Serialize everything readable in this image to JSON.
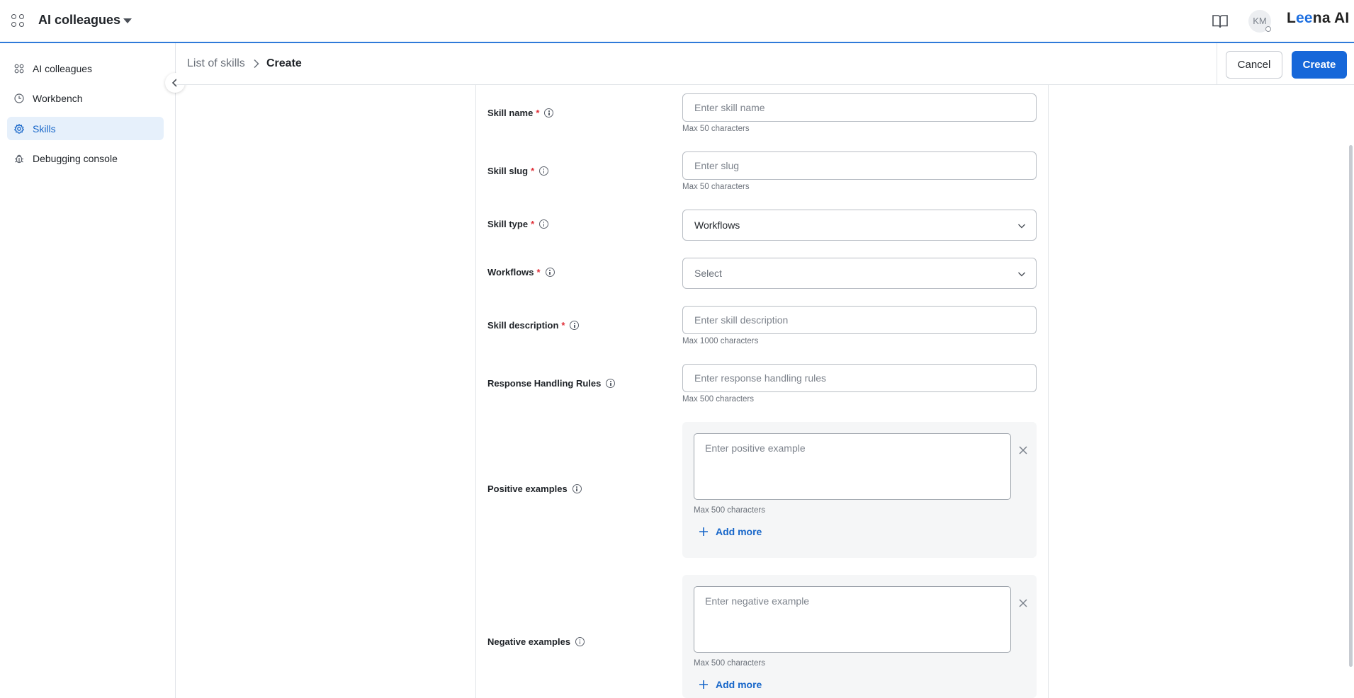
{
  "topbar": {
    "app_title": "AI colleagues",
    "avatar_initials": "KM",
    "logo_text": "Leena AI",
    "logo_prefix": "L",
    "logo_ee": "ee",
    "logo_suffix": "na AI",
    "icons": [
      "apps-grid-icon",
      "caret-down-icon",
      "book-icon",
      "avatar"
    ]
  },
  "sidebar": {
    "items": [
      {
        "label": "AI colleagues",
        "icon": "colleagues-icon",
        "active": false
      },
      {
        "label": "Workbench",
        "icon": "clock-icon",
        "active": false
      },
      {
        "label": "Skills",
        "icon": "gear-icon",
        "active": true
      },
      {
        "label": "Debugging console",
        "icon": "bug-icon",
        "active": false
      }
    ]
  },
  "breadcrumb": {
    "root": "List of skills",
    "current": "Create"
  },
  "actions": {
    "cancel_label": "Cancel",
    "create_label": "Create"
  },
  "form": {
    "skill_name": {
      "label": "Skill name",
      "required": "*",
      "placeholder": "Enter skill name",
      "value": "",
      "hint": "Max 50 characters"
    },
    "skill_slug": {
      "label": "Skill slug",
      "required": "*",
      "placeholder": "Enter slug",
      "value": "",
      "hint": "Max 50 characters"
    },
    "skill_type": {
      "label": "Skill type",
      "required": "*",
      "value": "Workflows"
    },
    "workflows": {
      "label": "Workflows",
      "required": "*",
      "value": "Select"
    },
    "skill_description": {
      "label": "Skill description",
      "required": "*",
      "placeholder": "Enter skill description",
      "value": "",
      "hint": "Max 1000 characters"
    },
    "response_rules": {
      "label": "Response Handling Rules",
      "placeholder": "Enter response handling rules",
      "value": "",
      "hint": "Max 500 characters"
    },
    "positive_examples": {
      "label": "Positive examples",
      "placeholder": "Enter positive example",
      "value": "",
      "hint": "Max 500 characters",
      "add_more": "Add more"
    },
    "negative_examples": {
      "label": "Negative examples",
      "placeholder": "Enter negative example",
      "value": "",
      "hint": "Max 500 characters",
      "add_more": "Add more"
    }
  },
  "colors": {
    "accent": "#1667d9",
    "active_nav_bg": "#e6f0fb",
    "required": "#e0313a",
    "topbar_border": "#2f7ad9"
  }
}
